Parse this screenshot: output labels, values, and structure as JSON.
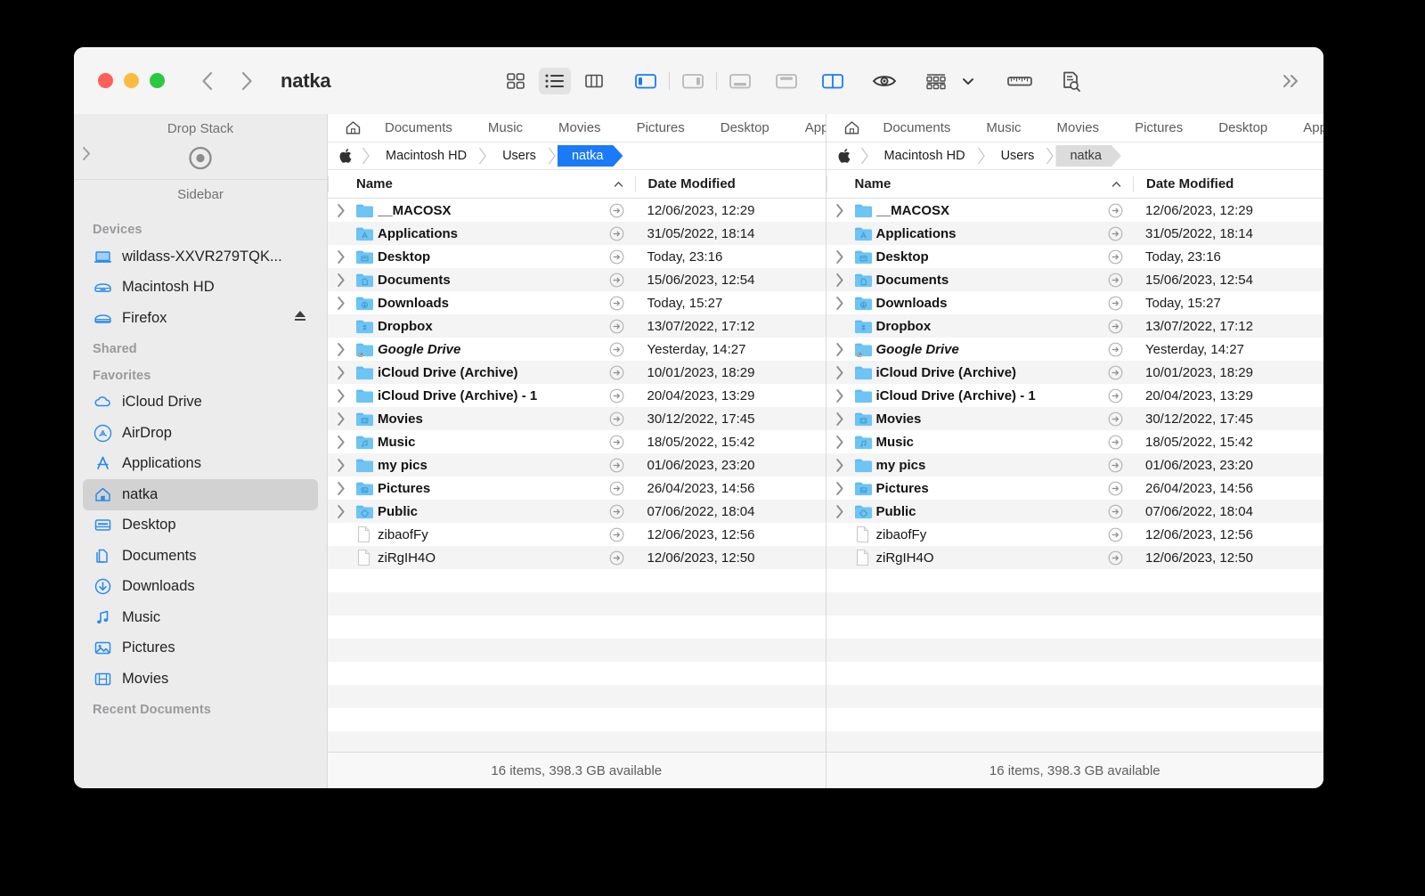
{
  "window": {
    "title": "natka",
    "traffic_lights": [
      "close",
      "minimize",
      "maximize"
    ],
    "nav_back": "back-chevron",
    "nav_forward": "forward-chevron"
  },
  "toolbar": {
    "view_icon_label": "icon-view",
    "view_list_label": "list-view",
    "view_column_label": "column-view",
    "layout_single_left": "layout-left-panel",
    "layout_single_right": "layout-right-panel",
    "layout_bottom": "layout-bottom-panel",
    "layout_top": "layout-top-panel",
    "layout_dual": "layout-dual-pane",
    "preview": "eye-icon",
    "group_by": "group-by-icon",
    "measure": "ruler-icon",
    "inspect": "document-search-icon",
    "more": "more-chevrons"
  },
  "sidebar": {
    "drop_stack_title": "Drop Stack",
    "sidebar_title": "Sidebar",
    "groups": [
      {
        "label": "Devices",
        "items": [
          {
            "label": "wildass-XXVR279TQK...",
            "icon": "laptop-icon",
            "selected": false,
            "eject": false
          },
          {
            "label": "Macintosh HD",
            "icon": "harddisk-icon",
            "selected": false,
            "eject": false
          },
          {
            "label": "Firefox",
            "icon": "harddisk-icon",
            "selected": false,
            "eject": true
          }
        ]
      },
      {
        "label": "Shared",
        "items": []
      },
      {
        "label": "Favorites",
        "items": [
          {
            "label": "iCloud Drive",
            "icon": "cloud-icon",
            "selected": false,
            "eject": false
          },
          {
            "label": "AirDrop",
            "icon": "airdrop-icon",
            "selected": false,
            "eject": false
          },
          {
            "label": "Applications",
            "icon": "appstore-icon",
            "selected": false,
            "eject": false
          },
          {
            "label": "natka",
            "icon": "home-icon",
            "selected": true,
            "eject": false
          },
          {
            "label": "Desktop",
            "icon": "desktop-icon",
            "selected": false,
            "eject": false
          },
          {
            "label": "Documents",
            "icon": "documents-icon",
            "selected": false,
            "eject": false
          },
          {
            "label": "Downloads",
            "icon": "downloads-icon",
            "selected": false,
            "eject": false
          },
          {
            "label": "Music",
            "icon": "music-note-icon",
            "selected": false,
            "eject": false
          },
          {
            "label": "Pictures",
            "icon": "picture-icon",
            "selected": false,
            "eject": false
          },
          {
            "label": "Movies",
            "icon": "film-icon",
            "selected": false,
            "eject": false
          }
        ]
      },
      {
        "label": "Recent Documents",
        "items": []
      }
    ]
  },
  "tabs": [
    "Documents",
    "Music",
    "Movies",
    "Pictures",
    "Desktop",
    "Applications"
  ],
  "breadcrumb": {
    "crumbs": [
      "Macintosh HD",
      "Users",
      "natka"
    ],
    "active": "natka"
  },
  "columns": {
    "name": "Name",
    "date": "Date Modified"
  },
  "status": "16 items, 398.3 GB available",
  "files": [
    {
      "name": "__MACOSX",
      "date": "12/06/2023, 12:29",
      "type": "folder",
      "icon": "folder-plain-icon",
      "expandable": true,
      "italic": false
    },
    {
      "name": "Applications",
      "date": "31/05/2022, 18:14",
      "type": "folder",
      "icon": "folder-applications-icon",
      "expandable": false,
      "italic": false
    },
    {
      "name": "Desktop",
      "date": "Today, 23:16",
      "type": "folder",
      "icon": "folder-desktop-icon",
      "expandable": true,
      "italic": false
    },
    {
      "name": "Documents",
      "date": "15/06/2023, 12:54",
      "type": "folder",
      "icon": "folder-documents-icon",
      "expandable": true,
      "italic": false
    },
    {
      "name": "Downloads",
      "date": "Today, 15:27",
      "type": "folder",
      "icon": "folder-downloads-icon",
      "expandable": true,
      "italic": false
    },
    {
      "name": "Dropbox",
      "date": "13/07/2022, 17:12",
      "type": "folder",
      "icon": "folder-dropbox-icon",
      "expandable": false,
      "italic": false
    },
    {
      "name": "Google Drive",
      "date": "Yesterday, 14:27",
      "type": "folder",
      "icon": "folder-alias-icon",
      "expandable": true,
      "italic": true
    },
    {
      "name": "iCloud Drive (Archive)",
      "date": "10/01/2023, 18:29",
      "type": "folder",
      "icon": "folder-plain-icon",
      "expandable": true,
      "italic": false
    },
    {
      "name": "iCloud Drive (Archive) - 1",
      "date": "20/04/2023, 13:29",
      "type": "folder",
      "icon": "folder-plain-icon",
      "expandable": true,
      "italic": false
    },
    {
      "name": "Movies",
      "date": "30/12/2022, 17:45",
      "type": "folder",
      "icon": "folder-movies-icon",
      "expandable": true,
      "italic": false
    },
    {
      "name": "Music",
      "date": "18/05/2022, 15:42",
      "type": "folder",
      "icon": "folder-music-icon",
      "expandable": true,
      "italic": false
    },
    {
      "name": "my pics",
      "date": "01/06/2023, 23:20",
      "type": "folder",
      "icon": "folder-plain-icon",
      "expandable": true,
      "italic": false
    },
    {
      "name": "Pictures",
      "date": "26/04/2023, 14:56",
      "type": "folder",
      "icon": "folder-pictures-icon",
      "expandable": true,
      "italic": false
    },
    {
      "name": "Public",
      "date": "07/06/2022, 18:04",
      "type": "folder",
      "icon": "folder-public-icon",
      "expandable": true,
      "italic": false
    },
    {
      "name": "zibaofFy",
      "date": "12/06/2023, 12:56",
      "type": "file",
      "icon": "document-blank-icon",
      "expandable": false,
      "italic": false
    },
    {
      "name": "ziRgIH4O",
      "date": "12/06/2023, 12:50",
      "type": "file",
      "icon": "document-blank-icon",
      "expandable": false,
      "italic": false
    }
  ],
  "colors": {
    "accent_blue": "#1a7af8",
    "folder_blue": "#59b8ef",
    "sidebar_bg": "#ececec",
    "row_stripe": "#f4f4f5",
    "traffic_red": "#fc6058",
    "traffic_yellow": "#fcbb40",
    "traffic_green": "#2bc840"
  }
}
